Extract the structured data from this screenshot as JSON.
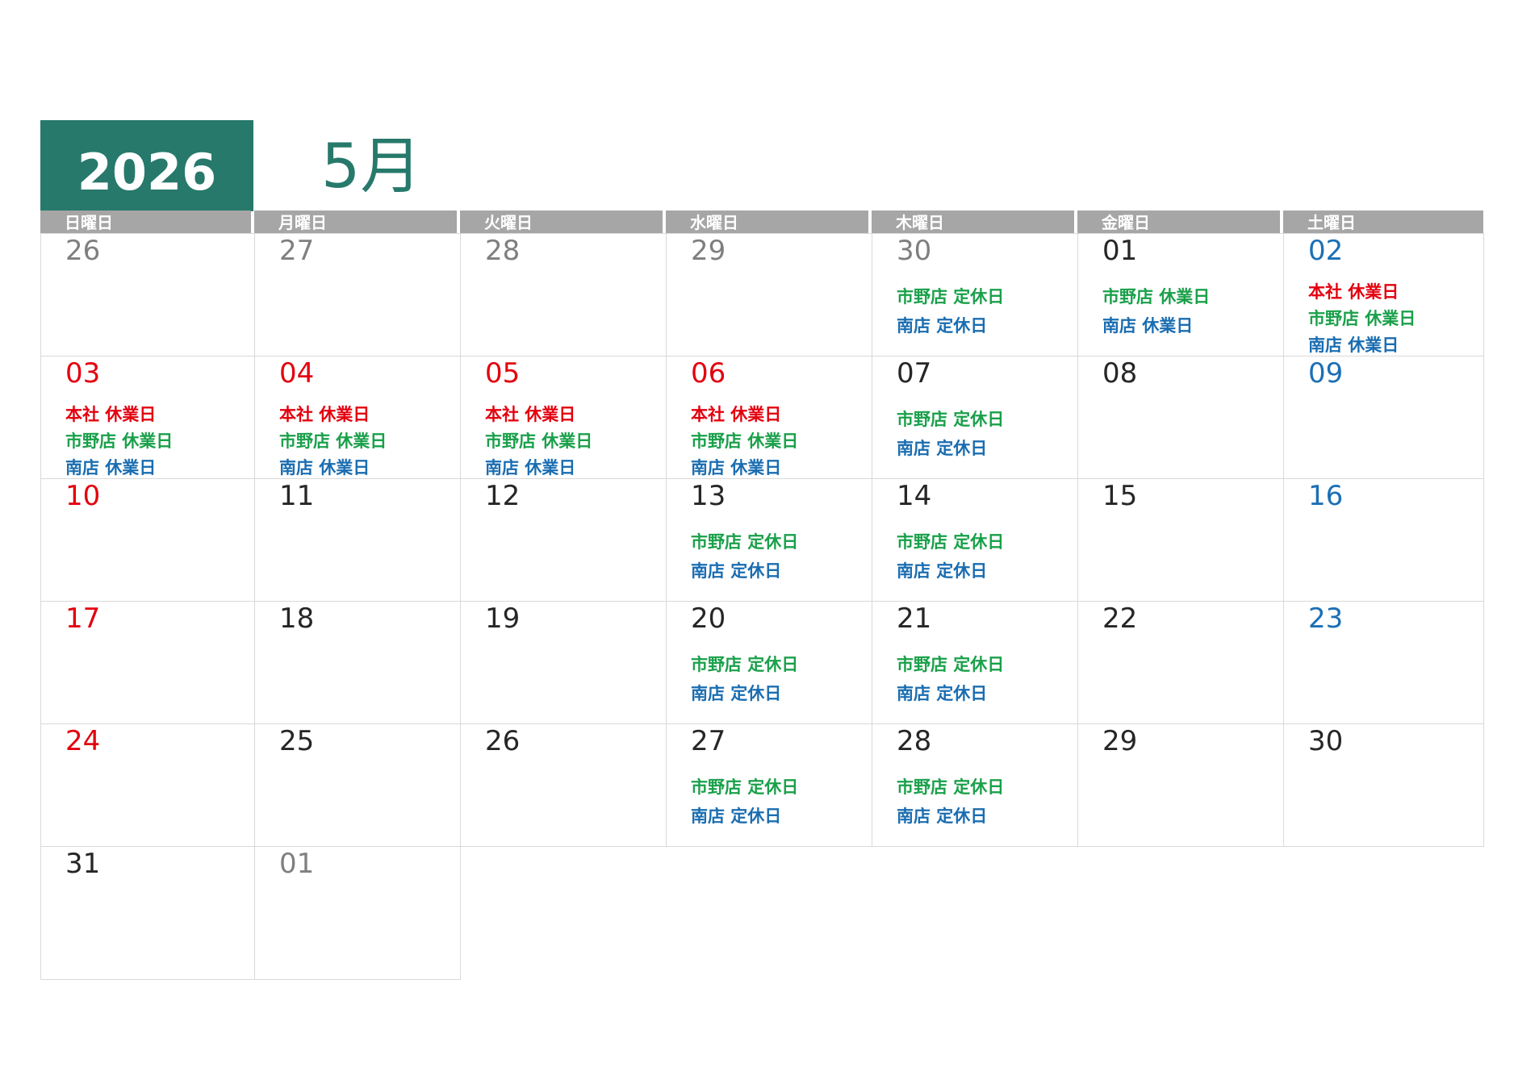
{
  "header": {
    "year": "2026",
    "month": "5月"
  },
  "weekdays": [
    "日曜日",
    "月曜日",
    "火曜日",
    "水曜日",
    "木曜日",
    "金曜日",
    "土曜日"
  ],
  "colors": {
    "brand": "#27796b",
    "weekday_bar": "#a6a6a6",
    "grid_line": "#d9d9d9",
    "other_month": "#7f7f7f",
    "weekday_text": "#262626",
    "sunday_holiday": "#e3000f",
    "saturday": "#1b6fb5",
    "honsha": "#e3000f",
    "ichino": "#1aa04a",
    "minami": "#1a6db1"
  },
  "weeks": [
    [
      {
        "day": "26",
        "style": "gray",
        "events": []
      },
      {
        "day": "27",
        "style": "gray",
        "events": []
      },
      {
        "day": "28",
        "style": "gray",
        "events": []
      },
      {
        "day": "29",
        "style": "gray",
        "events": []
      },
      {
        "day": "30",
        "style": "gray",
        "events": [
          {
            "text": "市野店 定休日",
            "color": "green"
          },
          {
            "text": "南店 定休日",
            "color": "navy"
          }
        ]
      },
      {
        "day": "01",
        "style": "black",
        "events": [
          {
            "text": "市野店 休業日",
            "color": "green"
          },
          {
            "text": "南店 休業日",
            "color": "navy"
          }
        ]
      },
      {
        "day": "02",
        "style": "blue",
        "events": [
          {
            "text": "本社 休業日",
            "color": "red"
          },
          {
            "text": "市野店 休業日",
            "color": "green"
          },
          {
            "text": "南店 休業日",
            "color": "navy"
          }
        ]
      }
    ],
    [
      {
        "day": "03",
        "style": "red",
        "events": [
          {
            "text": "本社 休業日",
            "color": "red"
          },
          {
            "text": "市野店 休業日",
            "color": "green"
          },
          {
            "text": "南店 休業日",
            "color": "navy"
          }
        ]
      },
      {
        "day": "04",
        "style": "red",
        "events": [
          {
            "text": "本社 休業日",
            "color": "red"
          },
          {
            "text": "市野店 休業日",
            "color": "green"
          },
          {
            "text": "南店 休業日",
            "color": "navy"
          }
        ]
      },
      {
        "day": "05",
        "style": "red",
        "events": [
          {
            "text": "本社 休業日",
            "color": "red"
          },
          {
            "text": "市野店 休業日",
            "color": "green"
          },
          {
            "text": "南店 休業日",
            "color": "navy"
          }
        ]
      },
      {
        "day": "06",
        "style": "red",
        "events": [
          {
            "text": "本社 休業日",
            "color": "red"
          },
          {
            "text": "市野店 休業日",
            "color": "green"
          },
          {
            "text": "南店 休業日",
            "color": "navy"
          }
        ]
      },
      {
        "day": "07",
        "style": "black",
        "events": [
          {
            "text": "市野店 定休日",
            "color": "green"
          },
          {
            "text": "南店 定休日",
            "color": "navy"
          }
        ]
      },
      {
        "day": "08",
        "style": "black",
        "events": []
      },
      {
        "day": "09",
        "style": "blue",
        "events": []
      }
    ],
    [
      {
        "day": "10",
        "style": "red",
        "events": []
      },
      {
        "day": "11",
        "style": "black",
        "events": []
      },
      {
        "day": "12",
        "style": "black",
        "events": []
      },
      {
        "day": "13",
        "style": "black",
        "events": [
          {
            "text": "市野店 定休日",
            "color": "green"
          },
          {
            "text": "南店 定休日",
            "color": "navy"
          }
        ]
      },
      {
        "day": "14",
        "style": "black",
        "events": [
          {
            "text": "市野店 定休日",
            "color": "green"
          },
          {
            "text": "南店 定休日",
            "color": "navy"
          }
        ]
      },
      {
        "day": "15",
        "style": "black",
        "events": []
      },
      {
        "day": "16",
        "style": "blue",
        "events": []
      }
    ],
    [
      {
        "day": "17",
        "style": "red",
        "events": []
      },
      {
        "day": "18",
        "style": "black",
        "events": []
      },
      {
        "day": "19",
        "style": "black",
        "events": []
      },
      {
        "day": "20",
        "style": "black",
        "events": [
          {
            "text": "市野店 定休日",
            "color": "green"
          },
          {
            "text": "南店 定休日",
            "color": "navy"
          }
        ]
      },
      {
        "day": "21",
        "style": "black",
        "events": [
          {
            "text": "市野店 定休日",
            "color": "green"
          },
          {
            "text": "南店 定休日",
            "color": "navy"
          }
        ]
      },
      {
        "day": "22",
        "style": "black",
        "events": []
      },
      {
        "day": "23",
        "style": "blue",
        "events": []
      }
    ],
    [
      {
        "day": "24",
        "style": "red",
        "events": []
      },
      {
        "day": "25",
        "style": "black",
        "events": []
      },
      {
        "day": "26",
        "style": "black",
        "events": []
      },
      {
        "day": "27",
        "style": "black",
        "events": [
          {
            "text": "市野店 定休日",
            "color": "green"
          },
          {
            "text": "南店 定休日",
            "color": "navy"
          }
        ]
      },
      {
        "day": "28",
        "style": "black",
        "events": [
          {
            "text": "市野店 定休日",
            "color": "green"
          },
          {
            "text": "南店 定休日",
            "color": "navy"
          }
        ]
      },
      {
        "day": "29",
        "style": "black",
        "events": []
      },
      {
        "day": "30",
        "style": "black",
        "events": []
      }
    ],
    [
      {
        "day": "31",
        "style": "black",
        "events": []
      },
      {
        "day": "01",
        "style": "gray",
        "events": []
      }
    ]
  ]
}
